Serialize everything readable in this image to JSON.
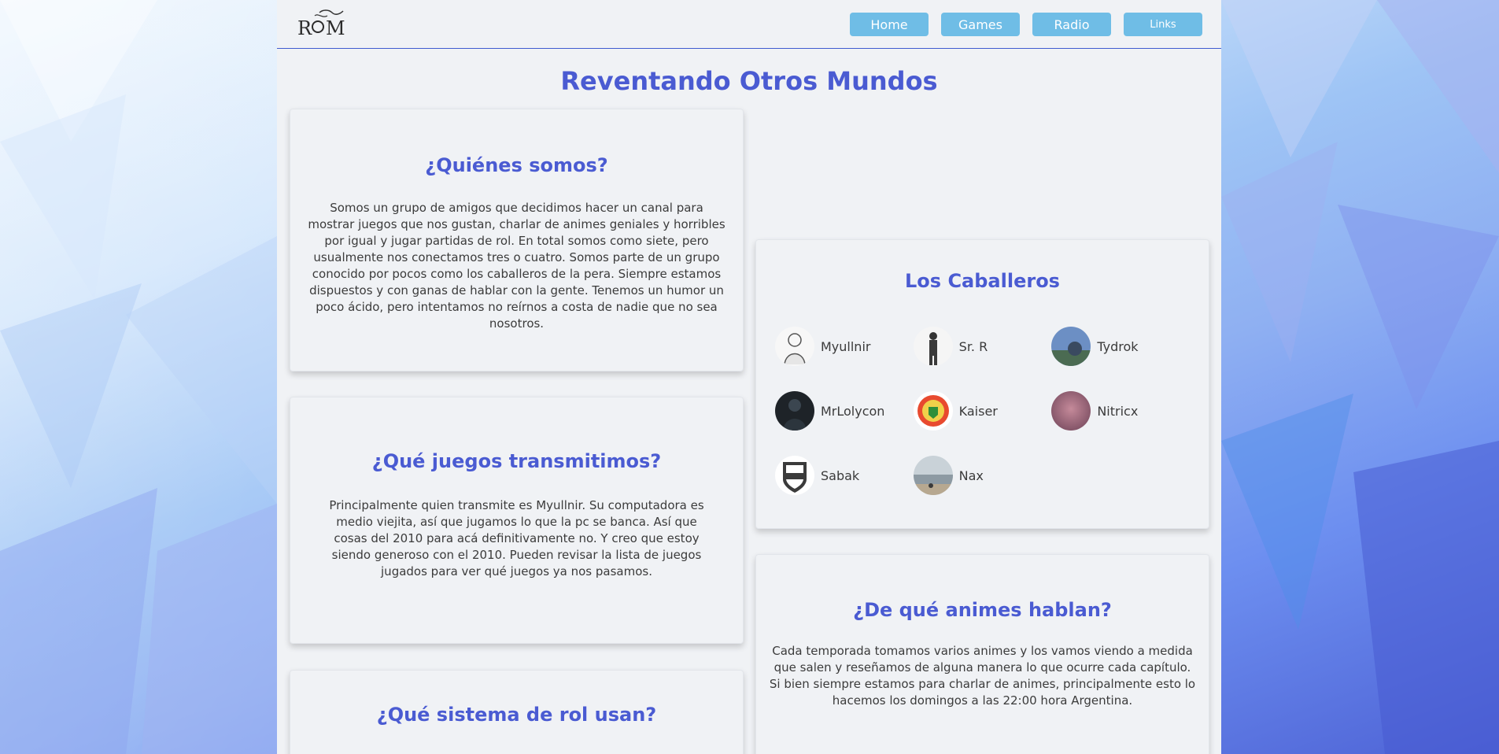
{
  "nav": {
    "logo_text": "R",
    "logo_text_b": "M",
    "items": [
      {
        "label": "Home"
      },
      {
        "label": "Games"
      },
      {
        "label": "Radio"
      },
      {
        "label": "Links"
      }
    ]
  },
  "site": {
    "title": "Reventando Otros Mundos"
  },
  "quienes": {
    "heading": "¿Quiénes somos?",
    "body": "Somos un grupo de amigos que decidimos hacer un canal para mostrar juegos que nos gustan, charlar de animes geniales y horribles por igual y jugar partidas de rol. En total somos como siete, pero usualmente nos conectamos tres o cuatro. Somos parte de un grupo conocido por pocos como los caballeros de la pera. Siempre estamos dispuestos y con ganas de hablar con la gente. Tenemos un humor un poco ácido, pero intentamos no reírnos a costa de nadie que no sea nosotros."
  },
  "juegos": {
    "heading": "¿Qué juegos transmitimos?",
    "body": "Principalmente quien transmite es Myullnir. Su computadora es medio viejita, así que jugamos lo que la pc se banca. Así que cosas del 2010 para acá definitivamente no. Y creo que estoy siendo generoso con el 2010. Pueden revisar la lista de juegos jugados para ver qué juegos ya nos pasamos."
  },
  "rol": {
    "heading": "¿Qué sistema de rol usan?"
  },
  "caballeros": {
    "heading": "Los Caballeros",
    "members": [
      {
        "name": "Myullnir",
        "avatar": "sketch-portrait-icon"
      },
      {
        "name": "Sr. R",
        "avatar": "soldier-figure-icon"
      },
      {
        "name": "Tydrok",
        "avatar": "landscape-photo-icon"
      },
      {
        "name": "MrLolycon",
        "avatar": "dark-character-icon"
      },
      {
        "name": "Kaiser",
        "avatar": "crest-badge-icon"
      },
      {
        "name": "Nitricx",
        "avatar": "blurred-photo-icon"
      },
      {
        "name": "Sabak",
        "avatar": "cap-shield-icon"
      },
      {
        "name": "Nax",
        "avatar": "beach-photo-icon"
      }
    ]
  },
  "animes": {
    "heading": "¿De qué animes hablan?",
    "body": "Cada temporada tomamos varios animes y los vamos viendo a medida que salen y reseñamos de alguna manera lo que ocurre cada capítulo. Si bien siempre estamos para charlar de animes, principalmente esto lo hacemos los domingos a las 22:00 hora Argentina."
  },
  "colors": {
    "accent": "#4a5bd2",
    "nav_button": "#6fbde6",
    "panel_bg": "#f0f2f5"
  }
}
